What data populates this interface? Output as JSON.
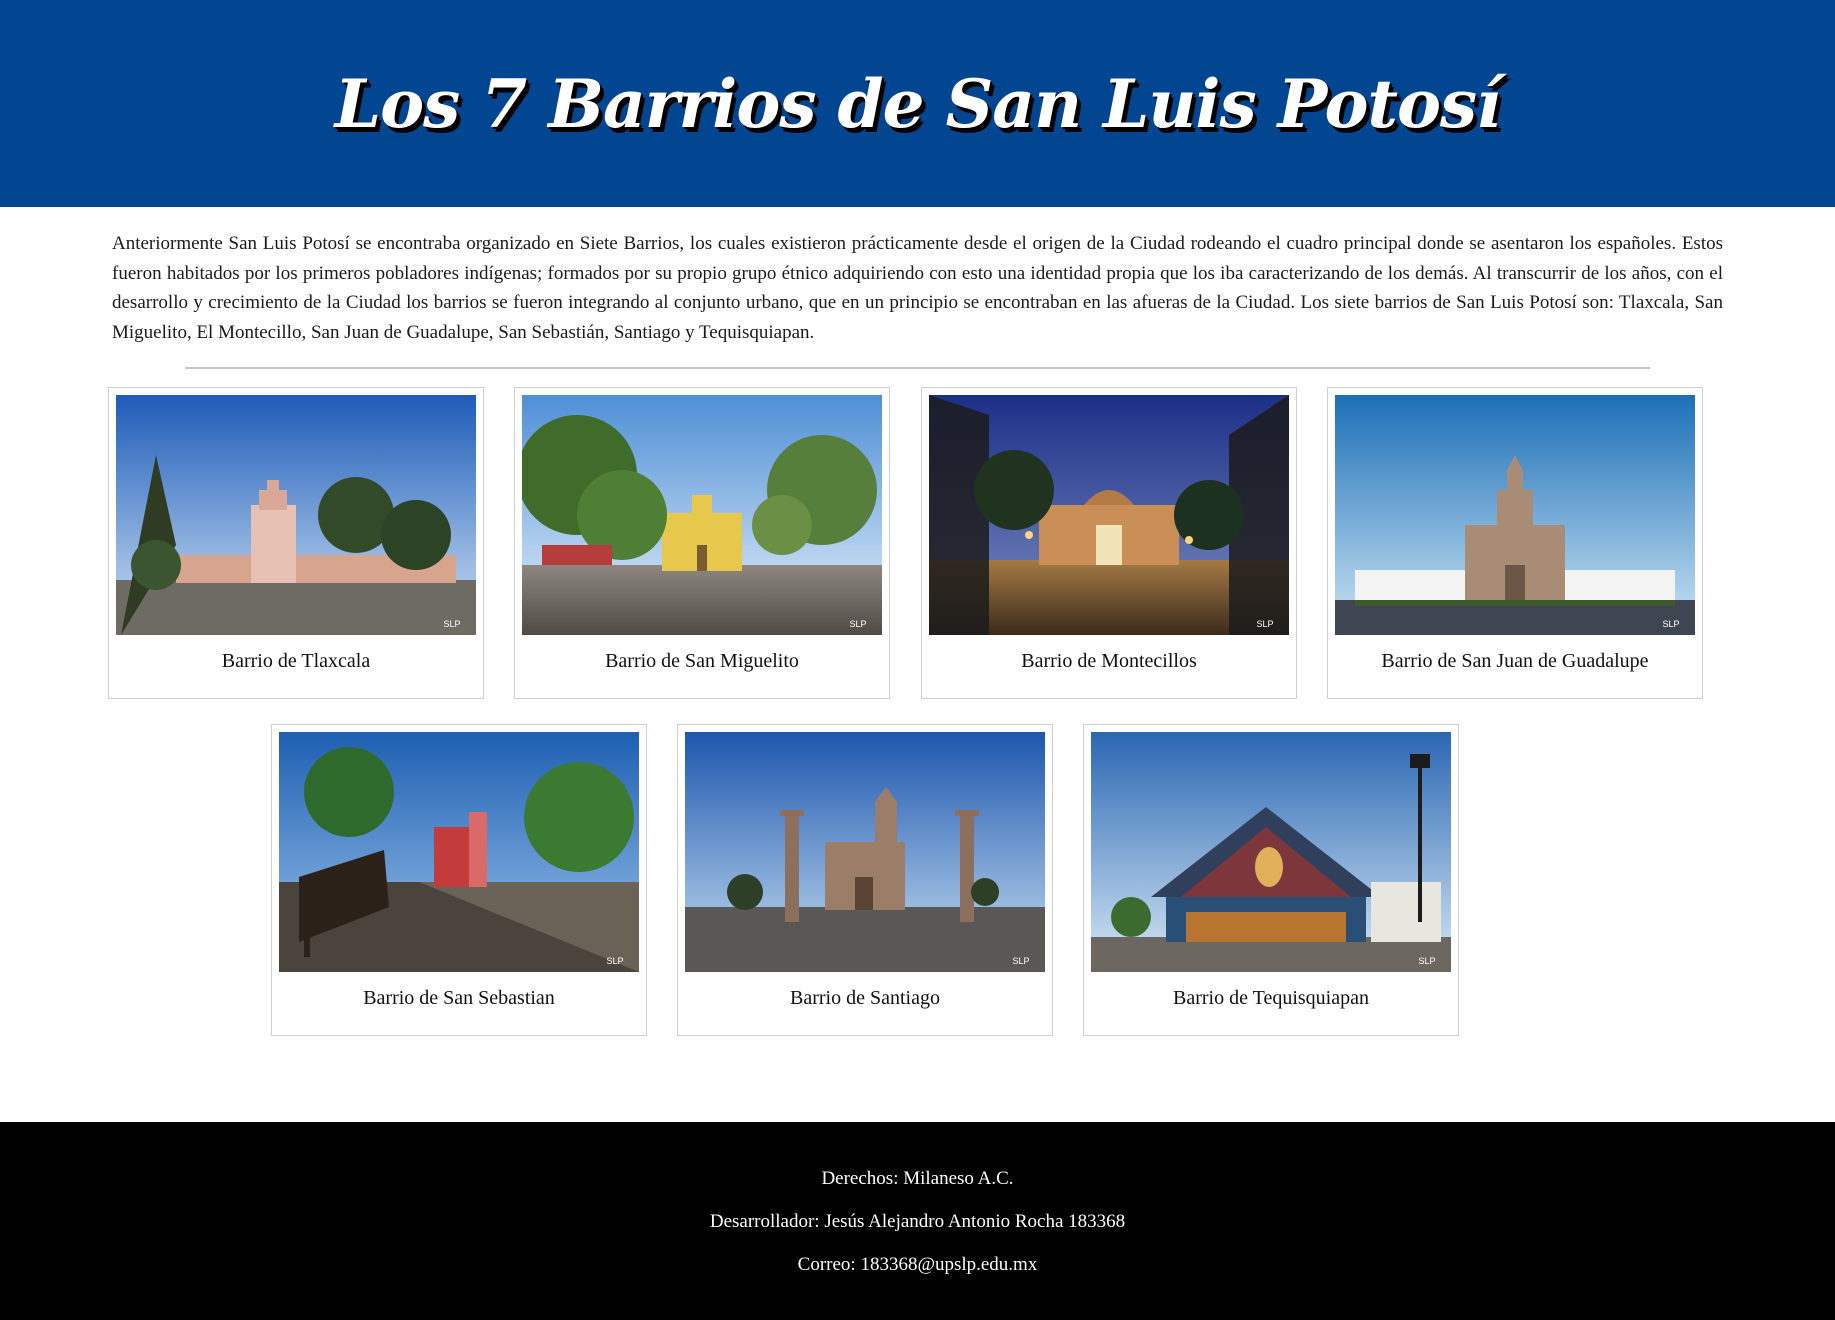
{
  "header": {
    "title": "Los 7 Barrios de San Luis Potosí"
  },
  "intro": {
    "text": "Anteriormente San Luis Potosí se encontraba organizado en Siete Barrios, los cuales existieron prácticamente desde el origen de la Ciudad rodeando el cuadro principal donde se asentaron los españoles. Estos fueron habitados por los primeros pobladores indígenas; formados por su propio grupo étnico adquiriendo con esto una identidad propia que los iba caracterizando de los demás. Al transcurrir de los años, con el desarrollo y crecimiento de la Ciudad los barrios se fueron integrando al conjunto urbano, que en un principio se encontraban en las afueras de la Ciudad. Los siete barrios de San Luis Potosí son: Tlaxcala, San Miguelito, El Montecillo, San Juan de Guadalupe, San Sebastián, Santiago y Tequisquiapan."
  },
  "barrios": [
    {
      "caption": "Barrio de Tlaxcala",
      "photo_logo": "SLP"
    },
    {
      "caption": "Barrio de San Miguelito",
      "photo_logo": "SLP"
    },
    {
      "caption": "Barrio de Montecillos",
      "photo_logo": "SLP"
    },
    {
      "caption": "Barrio de San Juan de Guadalupe",
      "photo_logo": "SLP"
    },
    {
      "caption": "Barrio de San Sebastian",
      "photo_logo": "SLP"
    },
    {
      "caption": "Barrio de Santiago",
      "photo_logo": "SLP"
    },
    {
      "caption": "Barrio de Tequisquiapan",
      "photo_logo": "SLP"
    }
  ],
  "footer": {
    "rights": "Derechos: Milaneso A.C.",
    "developer": "Desarrollador: Jesús Alejandro Antonio Rocha 183368",
    "email": "Correo: 183368@upslp.edu.mx"
  },
  "colors": {
    "header_bg": "#024691",
    "footer_bg": "#000000",
    "card_border": "#cfcfcf"
  }
}
